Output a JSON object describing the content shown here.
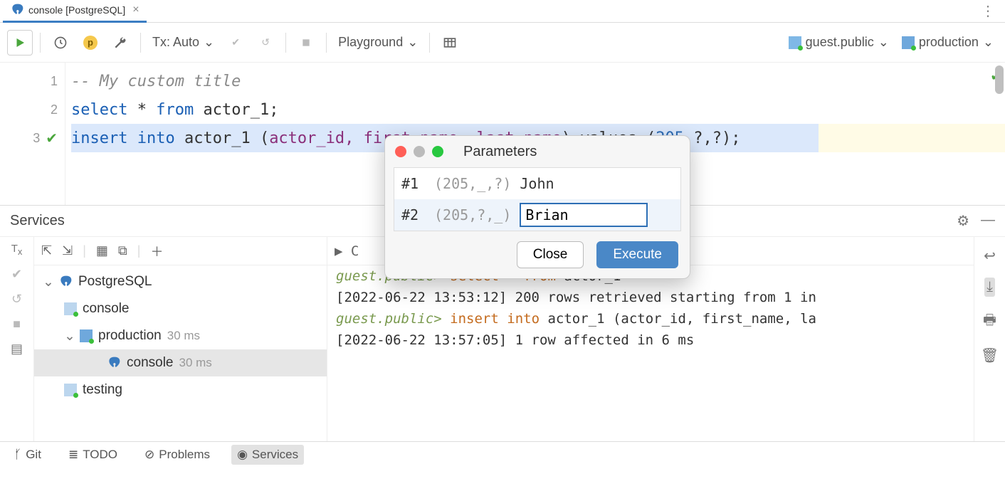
{
  "tab": {
    "title": "console [PostgreSQL]"
  },
  "toolbar": {
    "tx_label": "Tx: Auto",
    "playground_label": "Playground",
    "schema_label": "guest.public",
    "datasource_label": "production"
  },
  "editor": {
    "lines": [
      {
        "n": "1",
        "raw": "-- My custom title"
      },
      {
        "n": "2",
        "raw": "select * from actor_1;"
      },
      {
        "n": "3",
        "raw": "insert into actor_1 (actor_id, first_name, last_name) values (205,?,?);"
      }
    ],
    "tokens": {
      "comment": "-- My custom title",
      "select": "select",
      "star": "*",
      "from": "from",
      "actor": "actor_1",
      "semi": ";",
      "insert": "insert",
      "into": "into",
      "open": "(",
      "col1": "actor_id",
      "col2": ", first_name, last_name",
      "close_vals": ") values (",
      "num": "205",
      "tail": ",?,?);"
    }
  },
  "dialog": {
    "title": "Parameters",
    "rows": [
      {
        "idx": "#1",
        "pattern": "(205,_,?)",
        "value": "John"
      },
      {
        "idx": "#2",
        "pattern": "(205,?,_)",
        "value": "Brian"
      }
    ],
    "close": "Close",
    "execute": "Execute"
  },
  "services": {
    "title": "Services",
    "tree": {
      "root": "PostgreSQL",
      "console": "console",
      "production": "production",
      "production_time": "30 ms",
      "prod_console": "console",
      "prod_console_time": "30 ms",
      "testing": "testing"
    },
    "output": {
      "prompt": "guest.public>",
      "l1_sql": "select * from actor_1",
      "l2": "[2022-06-22 13:53:12] 200 rows retrieved starting from 1 in",
      "l3_sql": "insert into actor_1 (actor_id, first_name, la",
      "l4": "[2022-06-22 13:57:05] 1 row affected in 6 ms"
    }
  },
  "bottom": {
    "git": "Git",
    "todo": "TODO",
    "problems": "Problems",
    "services": "Services"
  }
}
